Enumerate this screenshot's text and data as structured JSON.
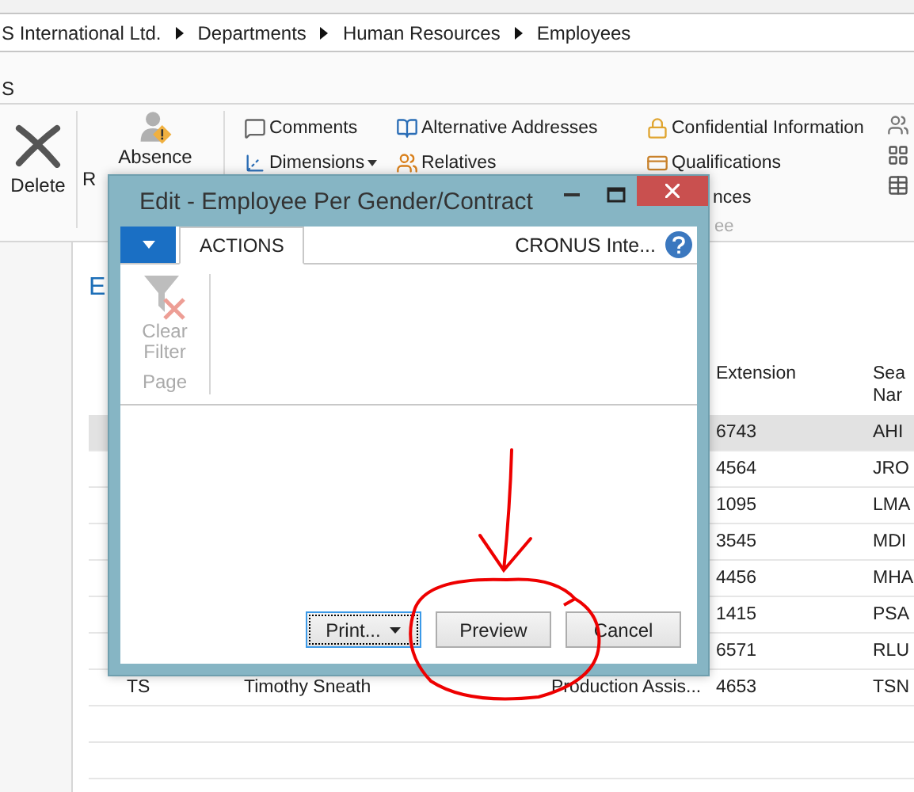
{
  "breadcrumb": [
    "S International Ltd.",
    "Departments",
    "Human Resources",
    "Employees"
  ],
  "ribbon_tab": "S",
  "ribbon": {
    "delete": "Delete",
    "absence": "Absence",
    "absence_next": "R",
    "columns": [
      [
        {
          "label": "Comments",
          "dropdown": false
        },
        {
          "label": "Dimensions",
          "dropdown": true
        }
      ],
      [
        {
          "label": "Alternative Addresses",
          "dropdown": false
        },
        {
          "label": "Relatives",
          "dropdown": false
        }
      ],
      [
        {
          "label": "Confidential Information",
          "dropdown": false
        },
        {
          "label": "Qualifications",
          "dropdown": false
        },
        {
          "label": "nces",
          "dropdown": false
        }
      ]
    ],
    "group_label": "ee"
  },
  "page_title": "E",
  "table": {
    "columns": [
      "Extension",
      "Sea Nar"
    ],
    "rows": [
      {
        "extension": "6743",
        "search": "AHI",
        "selected": true
      },
      {
        "extension": "4564",
        "search": "JRO",
        "selected": false
      },
      {
        "extension": "1095",
        "search": "LMA",
        "selected": false
      },
      {
        "extension": "3545",
        "search": "MDI",
        "selected": false
      },
      {
        "extension": "4456",
        "search": "MHA",
        "selected": false
      },
      {
        "extension": "1415",
        "search": "PSA",
        "selected": false
      },
      {
        "extension": "6571",
        "search": "RLU",
        "selected": false
      },
      {
        "code": "TS",
        "name": "Timothy Sneath",
        "job": "Production Assis...",
        "extension": "4653",
        "search": "TSN",
        "selected": false
      }
    ]
  },
  "dialog": {
    "title": "Edit - Employee Per Gender/Contract",
    "tabs": [
      {
        "label": "ACTIONS",
        "selected": true
      }
    ],
    "company": "CRONUS Inte...",
    "actions": [
      {
        "label": "Clear Filter",
        "disabled": true
      }
    ],
    "group": "Page",
    "buttons": [
      {
        "label": "Print...",
        "kind": "split",
        "focused": true
      },
      {
        "label": "Preview",
        "kind": "plain",
        "focused": false
      },
      {
        "label": "Cancel",
        "kind": "plain",
        "focused": false
      }
    ]
  }
}
